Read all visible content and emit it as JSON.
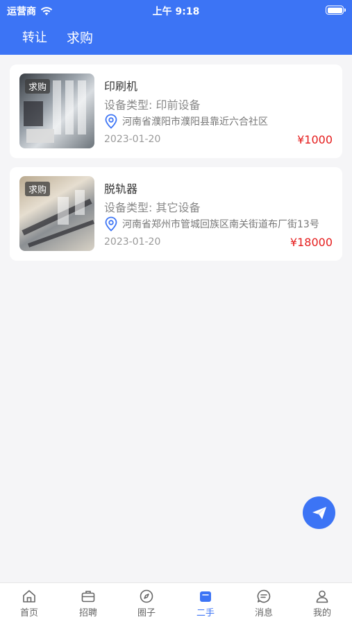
{
  "status_bar": {
    "carrier": "运营商",
    "time": "上午 9:18"
  },
  "header": {
    "tabs": [
      {
        "label": "转让",
        "active": false
      },
      {
        "label": "求购",
        "active": true
      }
    ],
    "background": "#3c74f5"
  },
  "listings": [
    {
      "badge": "求购",
      "title": "印刷机",
      "type": "设备类型: 印前设备",
      "location": "河南省濮阳市濮阳县靠近六合社区",
      "date": "2023-01-20",
      "price": "¥1000",
      "image": "printing-machine-photo"
    },
    {
      "badge": "求购",
      "title": "脱轨器",
      "type": "设备类型: 其它设备",
      "location": "河南省郑州市管城回族区南关街道布厂街13号",
      "date": "2023-01-20",
      "price": "¥18000",
      "image": "derailer-photo"
    }
  ],
  "fab_icon": "paper-plane-icon",
  "tabbar": [
    {
      "label": "首页",
      "icon": "home-icon",
      "active": false
    },
    {
      "label": "招聘",
      "icon": "briefcase-icon",
      "active": false
    },
    {
      "label": "圈子",
      "icon": "compass-icon",
      "active": false
    },
    {
      "label": "二手",
      "icon": "bag-icon",
      "active": true
    },
    {
      "label": "消息",
      "icon": "chat-icon",
      "active": false
    },
    {
      "label": "我的",
      "icon": "person-icon",
      "active": false
    }
  ],
  "colors": {
    "accent": "#3c74f5",
    "price": "#e51c1c",
    "background": "#f5f5f7"
  }
}
